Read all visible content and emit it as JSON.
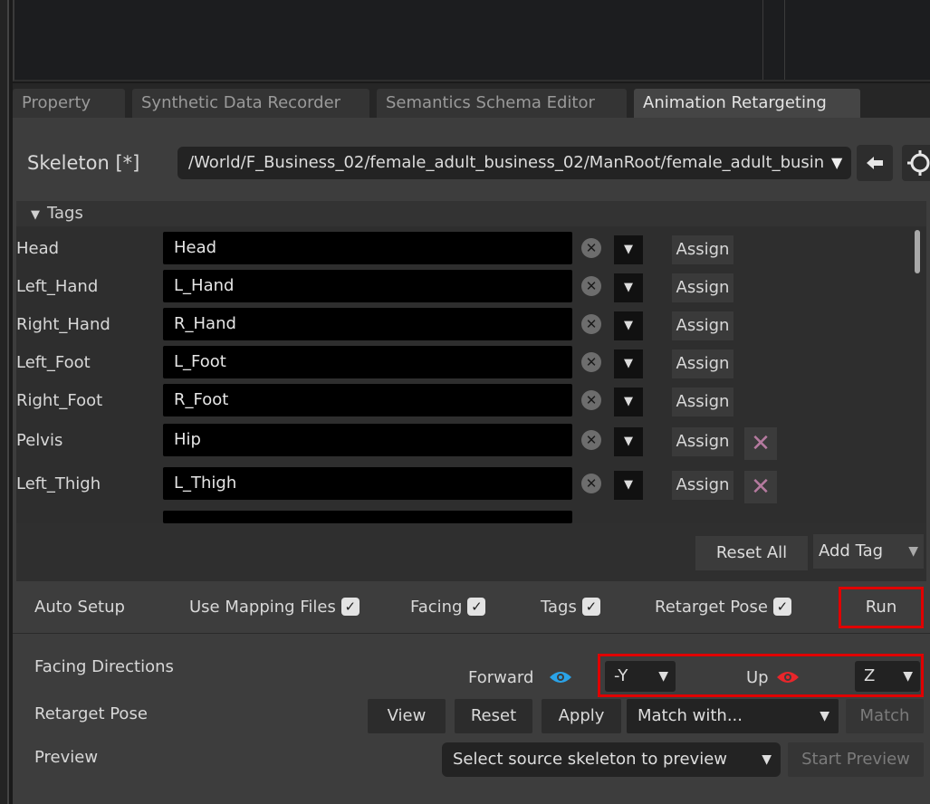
{
  "tabs": [
    {
      "label": "Property"
    },
    {
      "label": "Synthetic Data Recorder"
    },
    {
      "label": "Semantics Schema Editor"
    },
    {
      "label": "Animation Retargeting"
    }
  ],
  "skeleton": {
    "label": "Skeleton [*]",
    "path": "/World/F_Business_02/female_adult_business_02/ManRoot/female_adult_busin"
  },
  "tags_section": {
    "header": "Tags",
    "assign_label": "Assign",
    "rows": [
      {
        "name": "Head",
        "value": "Head"
      },
      {
        "name": "Left_Hand",
        "value": "L_Hand"
      },
      {
        "name": "Right_Hand",
        "value": "R_Hand"
      },
      {
        "name": "Left_Foot",
        "value": "L_Foot"
      },
      {
        "name": "Right_Foot",
        "value": "R_Foot"
      },
      {
        "name": "Pelvis",
        "value": "Hip"
      },
      {
        "name": "Left_Thigh",
        "value": "L_Thigh"
      }
    ],
    "reset_all_label": "Reset All",
    "add_tag_label": "Add Tag"
  },
  "auto_setup": {
    "label": "Auto Setup",
    "options": [
      {
        "label": "Use Mapping Files",
        "checked": true
      },
      {
        "label": "Facing",
        "checked": true
      },
      {
        "label": "Tags",
        "checked": true
      },
      {
        "label": "Retarget Pose",
        "checked": true
      }
    ],
    "run_label": "Run"
  },
  "facing": {
    "label": "Facing Directions",
    "forward_label": "Forward",
    "forward_value": "-Y",
    "up_label": "Up",
    "up_value": "Z",
    "forward_eye_color": "#2aa3e8",
    "up_eye_color": "#e8262b"
  },
  "retarget_pose": {
    "label": "Retarget Pose",
    "view_label": "View",
    "reset_label": "Reset",
    "apply_label": "Apply",
    "match_with": "Match with...",
    "match_label": "Match"
  },
  "preview": {
    "label": "Preview",
    "select_placeholder": "Select source skeleton to preview",
    "start_label": "Start Preview"
  }
}
